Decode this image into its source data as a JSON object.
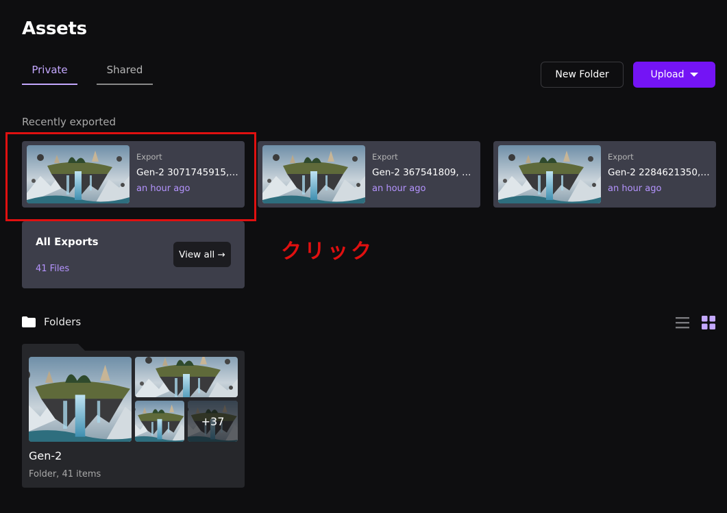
{
  "page": {
    "title": "Assets"
  },
  "tabs": [
    {
      "label": "Private",
      "active": true
    },
    {
      "label": "Shared",
      "active": false
    }
  ],
  "actions": {
    "new_folder_label": "New Folder",
    "upload_label": "Upload"
  },
  "recent": {
    "section_label": "Recently exported",
    "items": [
      {
        "kind": "Export",
        "name": "Gen-2 3071745915, T...",
        "time": "an hour ago"
      },
      {
        "kind": "Export",
        "name": "Gen-2 367541809, Th...",
        "time": "an hour ago"
      },
      {
        "kind": "Export",
        "name": "Gen-2 2284621350, ...",
        "time": "an hour ago"
      }
    ]
  },
  "all_exports": {
    "title": "All Exports",
    "count": "41 Files",
    "view_all_label": "View all →"
  },
  "annotation": {
    "text": "クリック",
    "color": "#e01010"
  },
  "folders": {
    "section_label": "Folders",
    "items": [
      {
        "name": "Gen-2",
        "info": "Folder, 41 items",
        "more_count": "+37"
      }
    ]
  },
  "colors": {
    "accent": "#7414f5",
    "accent_text": "#b594ff",
    "tab_active": "#c4a8ff",
    "card_bg": "#3d3e4a"
  },
  "icons": {
    "folder": "folder-icon",
    "list_view": "list-view-icon",
    "grid_view": "grid-view-icon",
    "dropdown": "caret-down-icon"
  }
}
